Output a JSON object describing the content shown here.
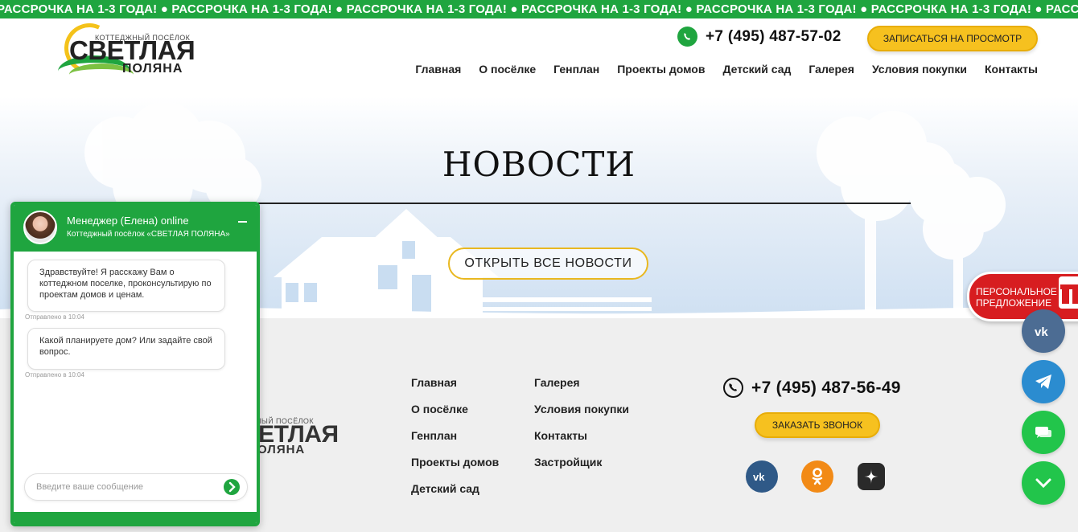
{
  "ticker": {
    "text": "РАССРОЧКА НА 1-3 ГОДА! ● РАССРОЧКА НА 1-3 ГОДА! ● РАССРОЧКА НА 1-3 ГОДА! ● РАССРОЧКА НА 1-3 ГОДА! ● РАССРОЧКА НА 1-3 ГОДА! ● РАССРОЧКА НА 1-3 ГОДА! ● РАССРОЧКА НА 1-3 ГОДА!"
  },
  "header": {
    "logo_small": "КОТТЕДЖНЫЙ ПОСЁЛОК",
    "logo_big": "СВЕТЛАЯ",
    "logo_sub": "ПОЛЯНА",
    "phone": "+7 (495) 487-57-02",
    "view_button": "ЗАПИСАТЬСЯ НА ПРОСМОТР",
    "nav": [
      "Главная",
      "О посёлке",
      "Генплан",
      "Проекты домов",
      "Детский сад",
      "Галерея",
      "Условия покупки",
      "Контакты"
    ]
  },
  "hero": {
    "title": "НОВОСТИ",
    "button": "ОТКРЫТЬ ВСЕ НОВОСТИ"
  },
  "footer": {
    "logo_small": "НЫЙ ПОСЁЛОК",
    "logo_big": "ВЕТЛАЯ",
    "logo_sub": "ОЛЯНА",
    "col1": [
      "Главная",
      "О посёлке",
      "Генплан",
      "Проекты домов",
      "Детский сад"
    ],
    "col2": [
      "Галерея",
      "Условия покупки",
      "Контакты",
      "Застройщик"
    ],
    "phone": "+7 (495) 487-56-49",
    "call_button": "ЗАКАЗАТЬ ЗВОНОК"
  },
  "personal": {
    "label_line1": "ПЕРСОНАЛЬНОЕ",
    "label_line2": "ПРЕДЛОЖЕНИЕ"
  },
  "chat": {
    "manager": "Менеджер (Елена) online",
    "company": "Коттеджный посёлок «СВЕТЛАЯ ПОЛЯНА»",
    "messages": [
      {
        "text": "Здравствуйте! Я расскажу Вам о коттеджном поселке, проконсультирую по проектам домов и ценам.",
        "time": "Отправлено в 10:04"
      },
      {
        "text": "Какой планируете дом? Или задайте свой вопрос.",
        "time": "Отправлено в 10:04"
      }
    ],
    "input_placeholder": "Введите ваше сообщение"
  },
  "colors": {
    "green": "#1fa53f",
    "yellow": "#f6c11f",
    "red": "#d71d20",
    "vk": "#4c6c93",
    "telegram": "#2b8cd0"
  },
  "icons": [
    "whatsapp-icon",
    "phone-icon",
    "vk-icon",
    "odnoklassniki-icon",
    "zen-icon",
    "telegram-icon",
    "chat-icon",
    "chevron-down-icon",
    "send-icon",
    "minimize-icon",
    "gift-icon"
  ]
}
